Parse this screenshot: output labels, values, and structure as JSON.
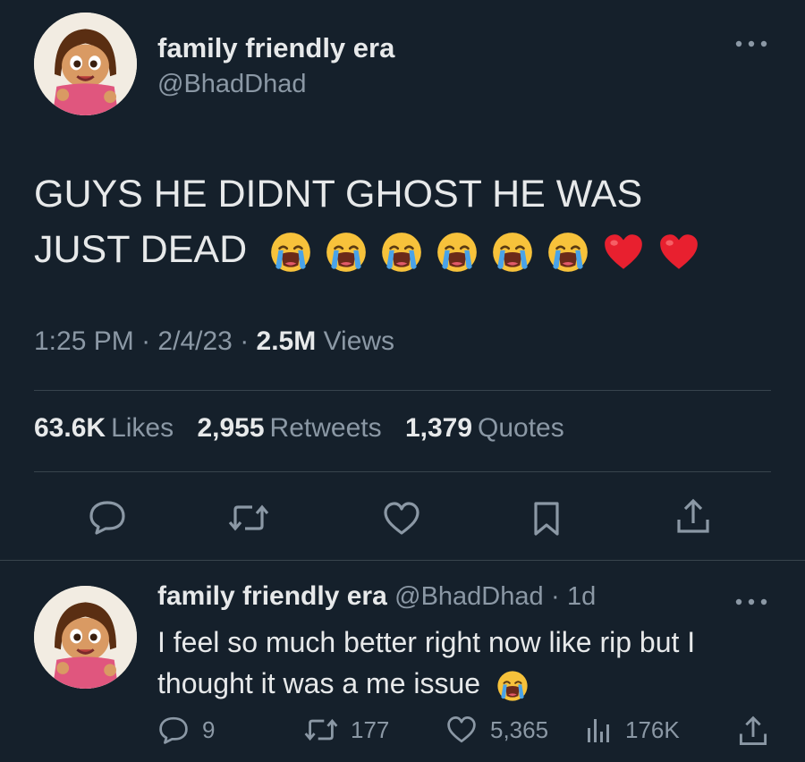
{
  "tweet": {
    "author_name": "family friendly era",
    "author_handle": "@BhadDhad",
    "more_icon": "more-horizontal-icon",
    "text_line1": "GUYS HE DIDNT GHOST HE WAS",
    "text_line2": "JUST DEAD",
    "emojis": [
      "loudly-crying-face",
      "loudly-crying-face",
      "loudly-crying-face",
      "loudly-crying-face",
      "loudly-crying-face",
      "loudly-crying-face",
      "red-heart",
      "red-heart"
    ],
    "time": "1:25 PM",
    "date": "2/4/23",
    "dot": "·",
    "views_count": "2.5M",
    "views_label": "Views",
    "likes_count": "63.6K",
    "likes_label": "Likes",
    "retweets_count": "2,955",
    "retweets_label": "Retweets",
    "quotes_count": "1,379",
    "quotes_label": "Quotes",
    "actions": [
      "reply-icon",
      "retweet-icon",
      "like-icon",
      "bookmark-icon",
      "share-icon"
    ]
  },
  "reply": {
    "author_name": "family friendly era",
    "author_handle": "@BhadDhad",
    "dot": "·",
    "age": "1d",
    "text_line1": "I feel so much better right now like rip but I",
    "text_line2": "thought it was a me issue",
    "reply_count": "9",
    "retweet_count": "177",
    "like_count": "5,365",
    "view_count": "176K"
  },
  "colors": {
    "background": "#15202b",
    "text": "#e7e9ea",
    "secondary": "#8b98a5",
    "divider": "#38444d",
    "heart": "#e8202f",
    "emoji_yellow": "#f7c23b",
    "tear_blue": "#4aa3e8"
  }
}
